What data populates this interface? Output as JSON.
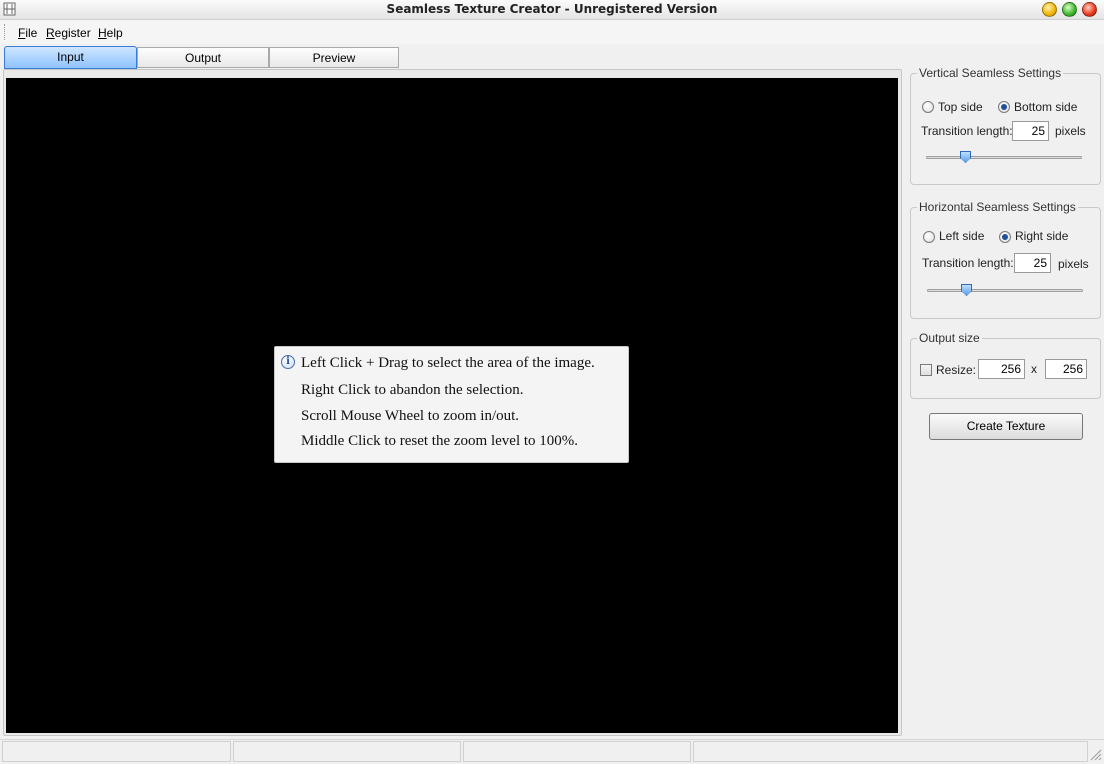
{
  "window": {
    "title": "Seamless Texture Creator - Unregistered Version"
  },
  "menu": {
    "items": [
      "File",
      "Register",
      "Help"
    ]
  },
  "tabs": [
    {
      "label": "Input",
      "active": true
    },
    {
      "label": "Output",
      "active": false
    },
    {
      "label": "Preview",
      "active": false
    }
  ],
  "tooltip": {
    "lines": [
      "Left Click + Drag to select the area of the image.",
      "Right Click to abandon the selection.",
      "Scroll Mouse Wheel to zoom in/out.",
      "Middle Click to reset the zoom level to 100%."
    ]
  },
  "vertical": {
    "title": "Vertical Seamless Settings",
    "option_top": "Top side",
    "option_bottom": "Bottom side",
    "selected": "Bottom side",
    "transition_label": "Transition length:",
    "transition_value": "25",
    "unit": "pixels",
    "slider_fraction": 0.25
  },
  "horizontal": {
    "title": "Horizontal Seamless Settings",
    "option_left": "Left side",
    "option_right": "Right side",
    "selected": "Right side",
    "transition_label": "Transition length:",
    "transition_value": "25",
    "unit": "pixels",
    "slider_fraction": 0.25
  },
  "output_size": {
    "title": "Output size",
    "resize_label": "Resize:",
    "resize_checked": false,
    "width": "256",
    "height": "256",
    "separator": "x"
  },
  "actions": {
    "create_label": "Create Texture"
  },
  "colors": {
    "canvas": "#000000",
    "tab_active": "#8ec3ff",
    "radio_checked": "#1f4f99"
  },
  "icons": [
    "app-icon",
    "info-icon",
    "minimize-icon",
    "maximize-icon",
    "close-icon",
    "resize-grip-icon"
  ]
}
